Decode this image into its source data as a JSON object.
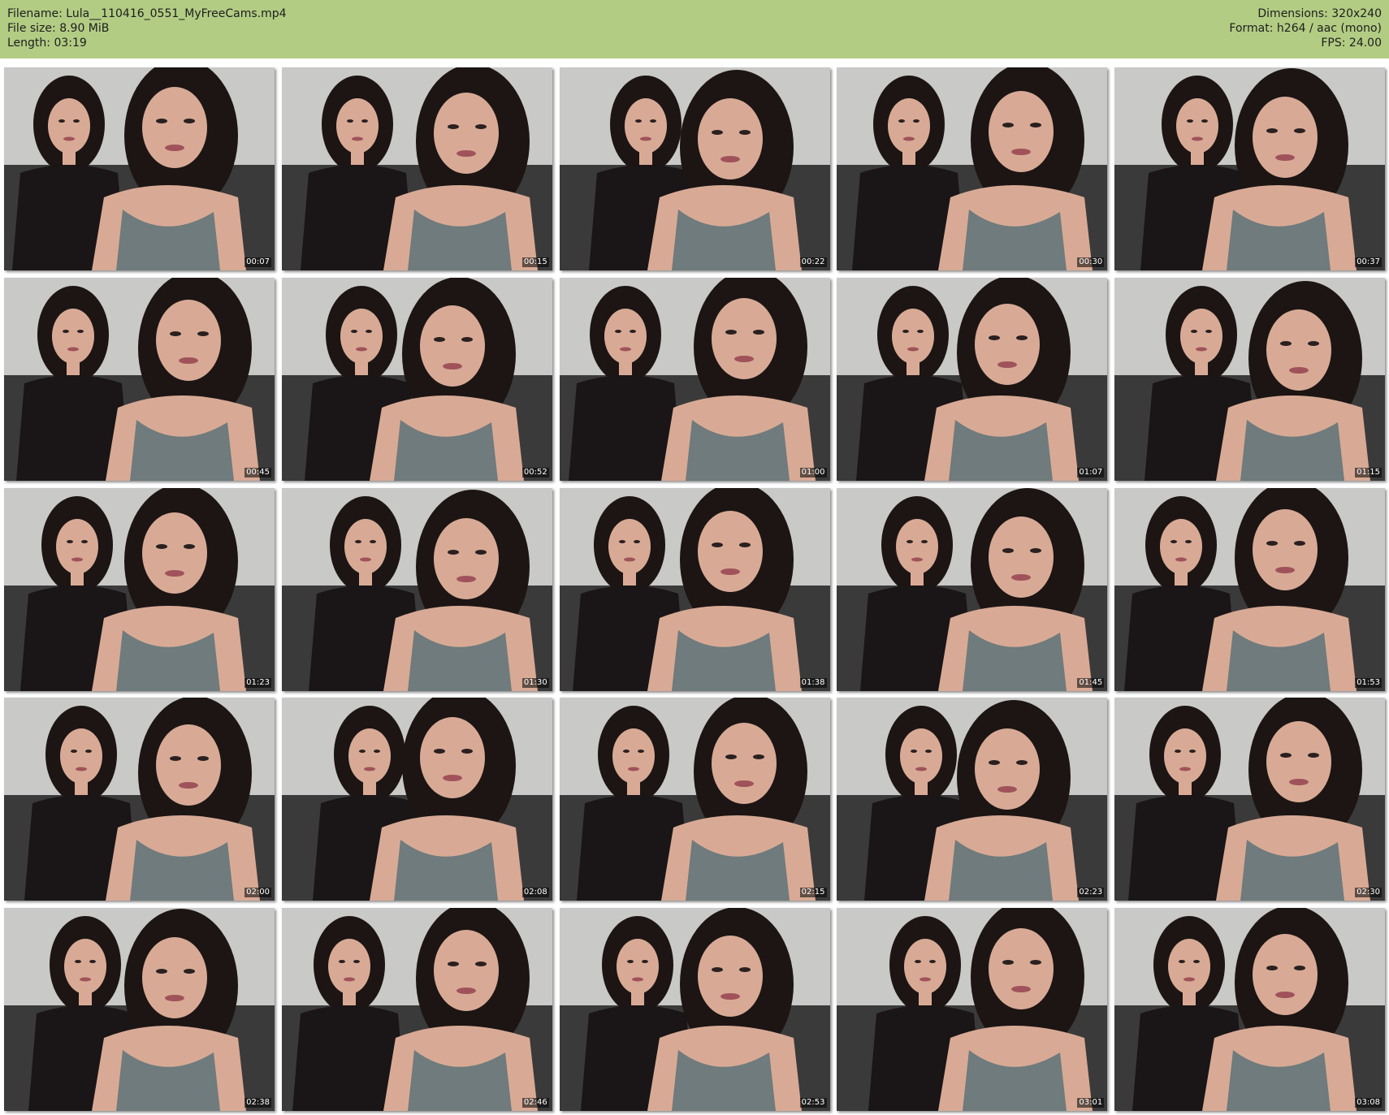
{
  "header": {
    "filename": "Filename: Lula__110416_0551_MyFreeCams.mp4",
    "filesize": "File size: 8.90 MiB",
    "length": "Length: 03:19",
    "dimensions": "Dimensions: 320x240",
    "format": "Format: h264 / aac (mono)",
    "fps": "FPS: 24.00"
  },
  "colors": {
    "header_bg": "#b2cc83",
    "wall": "#c9c9c7",
    "couch": "#3b3a3a",
    "skin": "#d8aa95",
    "hair": "#1c1514",
    "black_top": "#1a1516",
    "gray_top": "#6f7b7c"
  },
  "thumbnails": [
    {
      "time": "00:07"
    },
    {
      "time": "00:15"
    },
    {
      "time": "00:22"
    },
    {
      "time": "00:30"
    },
    {
      "time": "00:37"
    },
    {
      "time": "00:45"
    },
    {
      "time": "00:52"
    },
    {
      "time": "01:00"
    },
    {
      "time": "01:07"
    },
    {
      "time": "01:15"
    },
    {
      "time": "01:23"
    },
    {
      "time": "01:30"
    },
    {
      "time": "01:38"
    },
    {
      "time": "01:45"
    },
    {
      "time": "01:53"
    },
    {
      "time": "02:00"
    },
    {
      "time": "02:08"
    },
    {
      "time": "02:15"
    },
    {
      "time": "02:23"
    },
    {
      "time": "02:30"
    },
    {
      "time": "02:38"
    },
    {
      "time": "02:46"
    },
    {
      "time": "02:53"
    },
    {
      "time": "03:01"
    },
    {
      "time": "03:08"
    }
  ]
}
